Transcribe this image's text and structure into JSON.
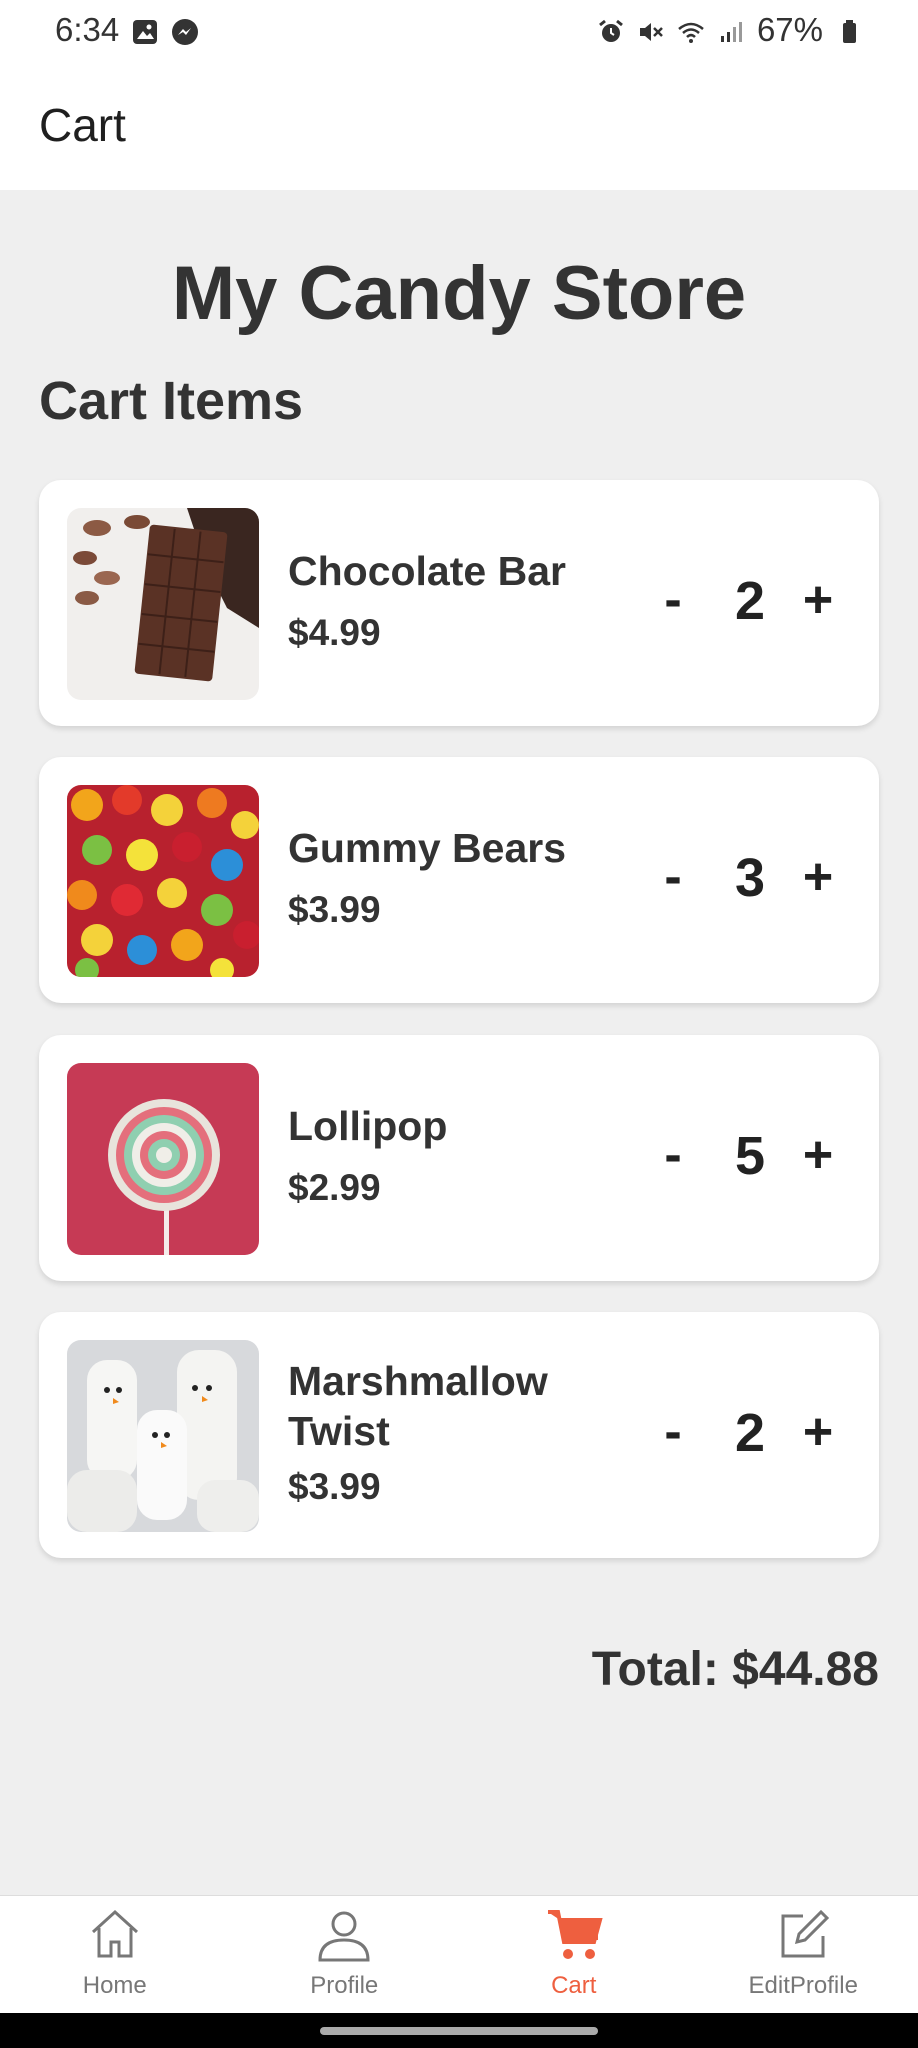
{
  "status_bar": {
    "time": "6:34",
    "battery": "67%",
    "left_icons": [
      "image-icon",
      "messenger-icon"
    ],
    "right_icons": [
      "alarm-icon",
      "mute-icon",
      "wifi-icon",
      "signal-icon",
      "battery-icon"
    ]
  },
  "app_bar": {
    "title": "Cart"
  },
  "store": {
    "title": "My Candy Store"
  },
  "cart": {
    "section_title": "Cart Items",
    "items": [
      {
        "name": "Chocolate Bar",
        "price": "$4.99",
        "quantity": "2",
        "minus": "-",
        "plus": "+"
      },
      {
        "name": "Gummy Bears",
        "price": "$3.99",
        "quantity": "3",
        "minus": "-",
        "plus": "+"
      },
      {
        "name": "Lollipop",
        "price": "$2.99",
        "quantity": "5",
        "minus": "-",
        "plus": "+"
      },
      {
        "name": "Marshmallow Twist",
        "price": "$3.99",
        "quantity": "2",
        "minus": "-",
        "plus": "+"
      }
    ],
    "total": "Total: $44.88"
  },
  "bottom_nav": {
    "active": "Cart",
    "accent_color": "#ee5f3f",
    "items": [
      {
        "label": "Home",
        "icon": "home-icon"
      },
      {
        "label": "Profile",
        "icon": "profile-icon"
      },
      {
        "label": "Cart",
        "icon": "cart-icon"
      },
      {
        "label": "EditProfile",
        "icon": "edit-icon"
      }
    ]
  }
}
